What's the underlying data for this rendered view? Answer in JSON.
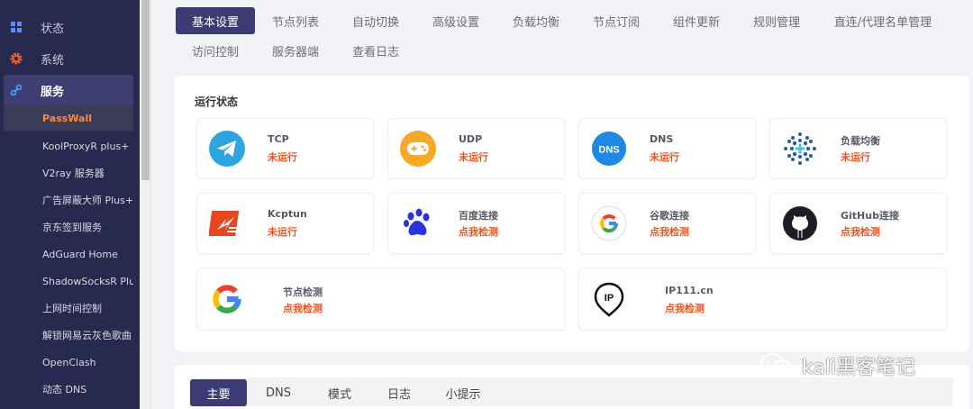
{
  "sidebar": {
    "items": [
      {
        "label": "状态",
        "icon": "dashboard-icon"
      },
      {
        "label": "系统",
        "icon": "gear-icon"
      },
      {
        "label": "服务",
        "icon": "link-icon"
      }
    ],
    "services": [
      "PassWall",
      "KoolProxyR plus+",
      "V2ray 服务器",
      "广告屏蔽大师 Plus+",
      "京东签到服务",
      "AdGuard Home",
      "ShadowSocksR Plus+",
      "上网时间控制",
      "解锁网易云灰色歌曲",
      "OpenClash",
      "动态 DNS"
    ]
  },
  "tabs": {
    "row1": [
      "基本设置",
      "节点列表",
      "自动切换",
      "高级设置",
      "负载均衡",
      "节点订阅",
      "组件更新",
      "规则管理",
      "直连/代理名单管理"
    ],
    "row2": [
      "访问控制",
      "服务器端",
      "查看日志"
    ]
  },
  "status": {
    "title": "运行状态",
    "tiles": [
      {
        "name": "TCP",
        "state": "未运行",
        "icon": "telegram-icon"
      },
      {
        "name": "UDP",
        "state": "未运行",
        "icon": "gamepad-icon"
      },
      {
        "name": "DNS",
        "state": "未运行",
        "icon": "dns-icon",
        "icon_text": "DNS"
      },
      {
        "name": "负载均衡",
        "state": "未运行",
        "icon": "load-balance-icon"
      },
      {
        "name": "Kcptun",
        "state": "未运行",
        "icon": "kcptun-icon"
      },
      {
        "name": "百度连接",
        "state": "点我检测",
        "icon": "baidu-paw-icon"
      },
      {
        "name": "谷歌连接",
        "state": "点我检测",
        "icon": "google-icon"
      },
      {
        "name": "GitHub连接",
        "state": "点我检测",
        "icon": "github-icon"
      },
      {
        "name": "节点检测",
        "state": "点我检测",
        "icon": "google-icon"
      },
      {
        "name": "IP111.cn",
        "state": "点我检测",
        "icon": "ip-pin-icon",
        "icon_text": "IP"
      }
    ]
  },
  "bottom_tabs": [
    "主要",
    "DNS",
    "模式",
    "日志",
    "小提示"
  ],
  "watermark": {
    "text": "kali黑客笔记"
  },
  "colors": {
    "sidebar_bg": "#28294e",
    "accent": "#3d3b73",
    "active_service": "#ff8a3d",
    "state_red": "#f0541c"
  }
}
